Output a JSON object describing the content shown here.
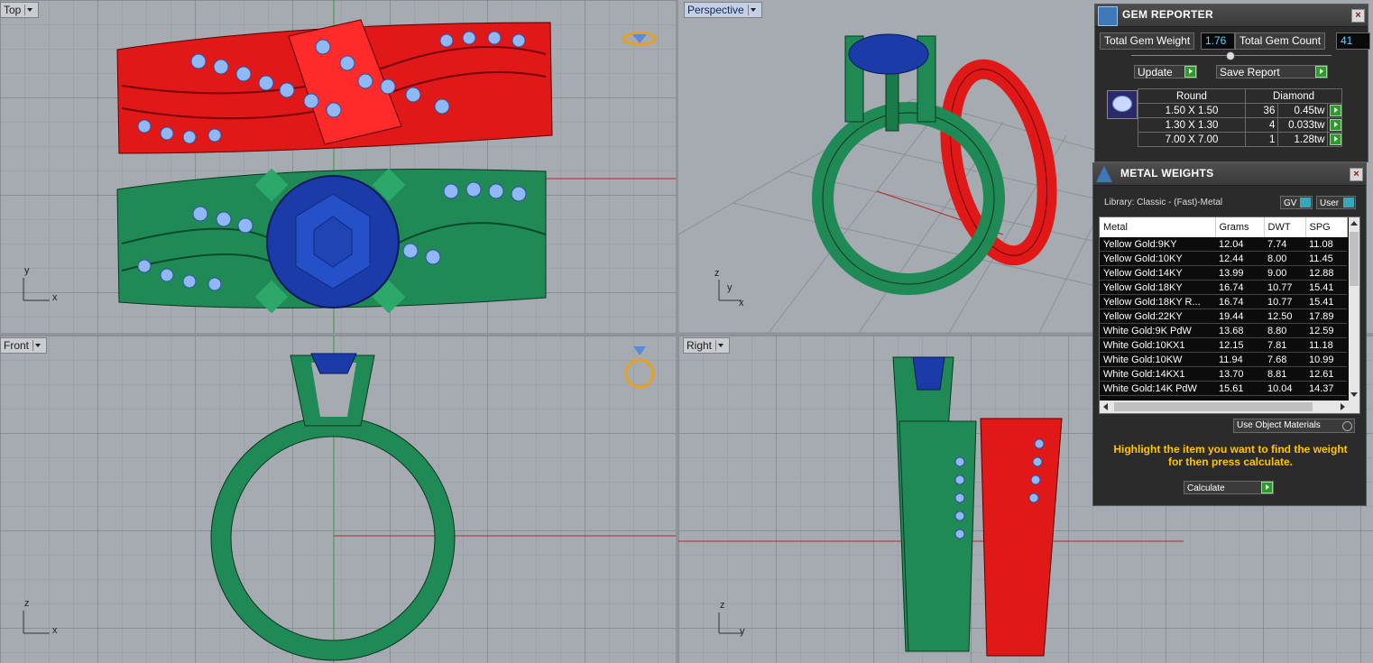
{
  "viewports": {
    "top": {
      "label": "Top"
    },
    "perspective": {
      "label": "Perspective"
    },
    "front": {
      "label": "Front"
    },
    "right": {
      "label": "Right"
    }
  },
  "axes": {
    "x": "x",
    "y": "y",
    "z": "z"
  },
  "gem_reporter": {
    "title": "GEM REPORTER",
    "close": "×",
    "total_weight_label": "Total Gem Weight",
    "total_weight_value": "1.76",
    "total_count_label": "Total Gem Count",
    "total_count_value": "41",
    "update_label": "Update",
    "save_report_label": "Save Report",
    "table_headers": [
      "Round",
      "Diamond"
    ],
    "rows": [
      {
        "size": "1.50 X 1.50",
        "count": "36",
        "weight": "0.45tw"
      },
      {
        "size": "1.30 X 1.30",
        "count": "4",
        "weight": "0.033tw"
      },
      {
        "size": "7.00 X 7.00",
        "count": "1",
        "weight": "1.28tw"
      }
    ]
  },
  "metal_weights": {
    "title": "METAL WEIGHTS",
    "close": "×",
    "library_label": "Library: Classic - (Fast)-Metal",
    "gv_label": "GV",
    "user_label": "User",
    "headers": [
      "Metal",
      "Grams",
      "DWT",
      "SPG"
    ],
    "rows": [
      {
        "metal": "Yellow Gold:9KY",
        "grams": "12.04",
        "dwt": "7.74",
        "spg": "11.08"
      },
      {
        "metal": "Yellow Gold:10KY",
        "grams": "12.44",
        "dwt": "8.00",
        "spg": "11.45"
      },
      {
        "metal": "Yellow Gold:14KY",
        "grams": "13.99",
        "dwt": "9.00",
        "spg": "12.88"
      },
      {
        "metal": "Yellow Gold:18KY",
        "grams": "16.74",
        "dwt": "10.77",
        "spg": "15.41"
      },
      {
        "metal": "Yellow Gold:18KY R...",
        "grams": "16.74",
        "dwt": "10.77",
        "spg": "15.41"
      },
      {
        "metal": "Yellow Gold:22KY",
        "grams": "19.44",
        "dwt": "12.50",
        "spg": "17.89"
      },
      {
        "metal": "White Gold:9K PdW",
        "grams": "13.68",
        "dwt": "8.80",
        "spg": "12.59"
      },
      {
        "metal": "White Gold:10KX1",
        "grams": "12.15",
        "dwt": "7.81",
        "spg": "11.18"
      },
      {
        "metal": "White Gold:10KW",
        "grams": "11.94",
        "dwt": "7.68",
        "spg": "10.99"
      },
      {
        "metal": "White Gold:14KX1",
        "grams": "13.70",
        "dwt": "8.81",
        "spg": "12.61"
      },
      {
        "metal": "White Gold:14K PdW",
        "grams": "15.61",
        "dwt": "10.04",
        "spg": "14.37"
      }
    ],
    "use_object_materials_label": "Use Object Materials",
    "hint": "Highlight the item you want to find the weight for then press calculate.",
    "calculate_label": "Calculate"
  },
  "colors": {
    "red_ring": "#e01818",
    "green_ring": "#1f8a55",
    "sapphire": "#1b3ba8",
    "stone": "#8fb8f5",
    "hint_text": "#ffc400",
    "value_text": "#5fd0ff"
  }
}
